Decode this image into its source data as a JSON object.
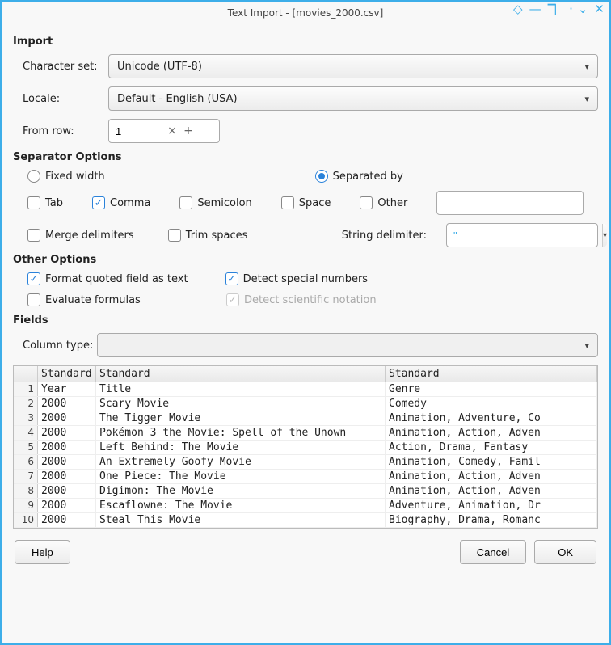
{
  "titlebar": {
    "title": "Text Import - [movies_2000.csv]"
  },
  "import": {
    "section": "Import",
    "charset_label": "Character set:",
    "charset_value": "Unicode (UTF-8)",
    "locale_label": "Locale:",
    "locale_value": "Default - English (USA)",
    "fromrow_label": "From row:",
    "fromrow_value": "1"
  },
  "separator": {
    "section": "Separator Options",
    "fixed": "Fixed width",
    "separated": "Separated by",
    "tab": "Tab",
    "comma": "Comma",
    "semicolon": "Semicolon",
    "space": "Space",
    "other": "Other",
    "other_value": "",
    "merge": "Merge delimiters",
    "trim": "Trim spaces",
    "string_delim_label": "String delimiter:",
    "string_delim_value": "\""
  },
  "other": {
    "section": "Other Options",
    "format_quoted": "Format quoted field as text",
    "detect_special": "Detect special numbers",
    "evaluate": "Evaluate formulas",
    "detect_sci": "Detect scientific notation"
  },
  "fields": {
    "section": "Fields",
    "coltype_label": "Column type:",
    "coltype_value": "",
    "headers": [
      "Standard",
      "Standard",
      "Standard"
    ],
    "rows": [
      {
        "n": "1",
        "cells": [
          "Year",
          "Title",
          "Genre"
        ]
      },
      {
        "n": "2",
        "cells": [
          "2000",
          "Scary Movie",
          "Comedy"
        ]
      },
      {
        "n": "3",
        "cells": [
          "2000",
          "The Tigger Movie",
          "Animation, Adventure, Co"
        ]
      },
      {
        "n": "4",
        "cells": [
          "2000",
          "Pokémon 3 the Movie: Spell of the Unown",
          "Animation, Action, Adven"
        ]
      },
      {
        "n": "5",
        "cells": [
          "2000",
          "Left Behind: The Movie",
          "Action, Drama, Fantasy"
        ]
      },
      {
        "n": "6",
        "cells": [
          "2000",
          "An Extremely Goofy Movie",
          "Animation, Comedy, Famil"
        ]
      },
      {
        "n": "7",
        "cells": [
          "2000",
          "One Piece: The Movie",
          "Animation, Action, Adven"
        ]
      },
      {
        "n": "8",
        "cells": [
          "2000",
          "Digimon: The Movie",
          "Animation, Action, Adven"
        ]
      },
      {
        "n": "9",
        "cells": [
          "2000",
          "Escaflowne: The Movie",
          "Adventure, Animation, Dr"
        ]
      },
      {
        "n": "10",
        "cells": [
          "2000",
          "Steal This Movie",
          "Biography, Drama, Romanc"
        ]
      }
    ]
  },
  "buttons": {
    "help": "Help",
    "cancel": "Cancel",
    "ok": "OK"
  }
}
